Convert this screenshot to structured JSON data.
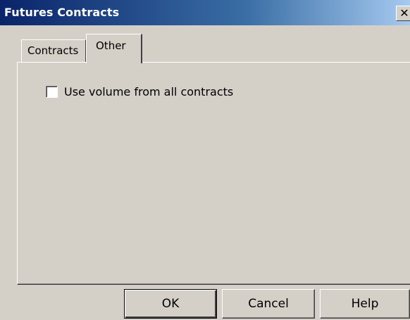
{
  "window": {
    "title": "Futures Contracts",
    "close_glyph": "✕"
  },
  "tabs": [
    {
      "label": "Contracts",
      "selected": false
    },
    {
      "label": "Other",
      "selected": true
    }
  ],
  "other_tab": {
    "checkbox_label": "Use volume from all contracts",
    "checkbox_checked": false
  },
  "buttons": {
    "ok": "OK",
    "cancel": "Cancel",
    "help": "Help"
  }
}
